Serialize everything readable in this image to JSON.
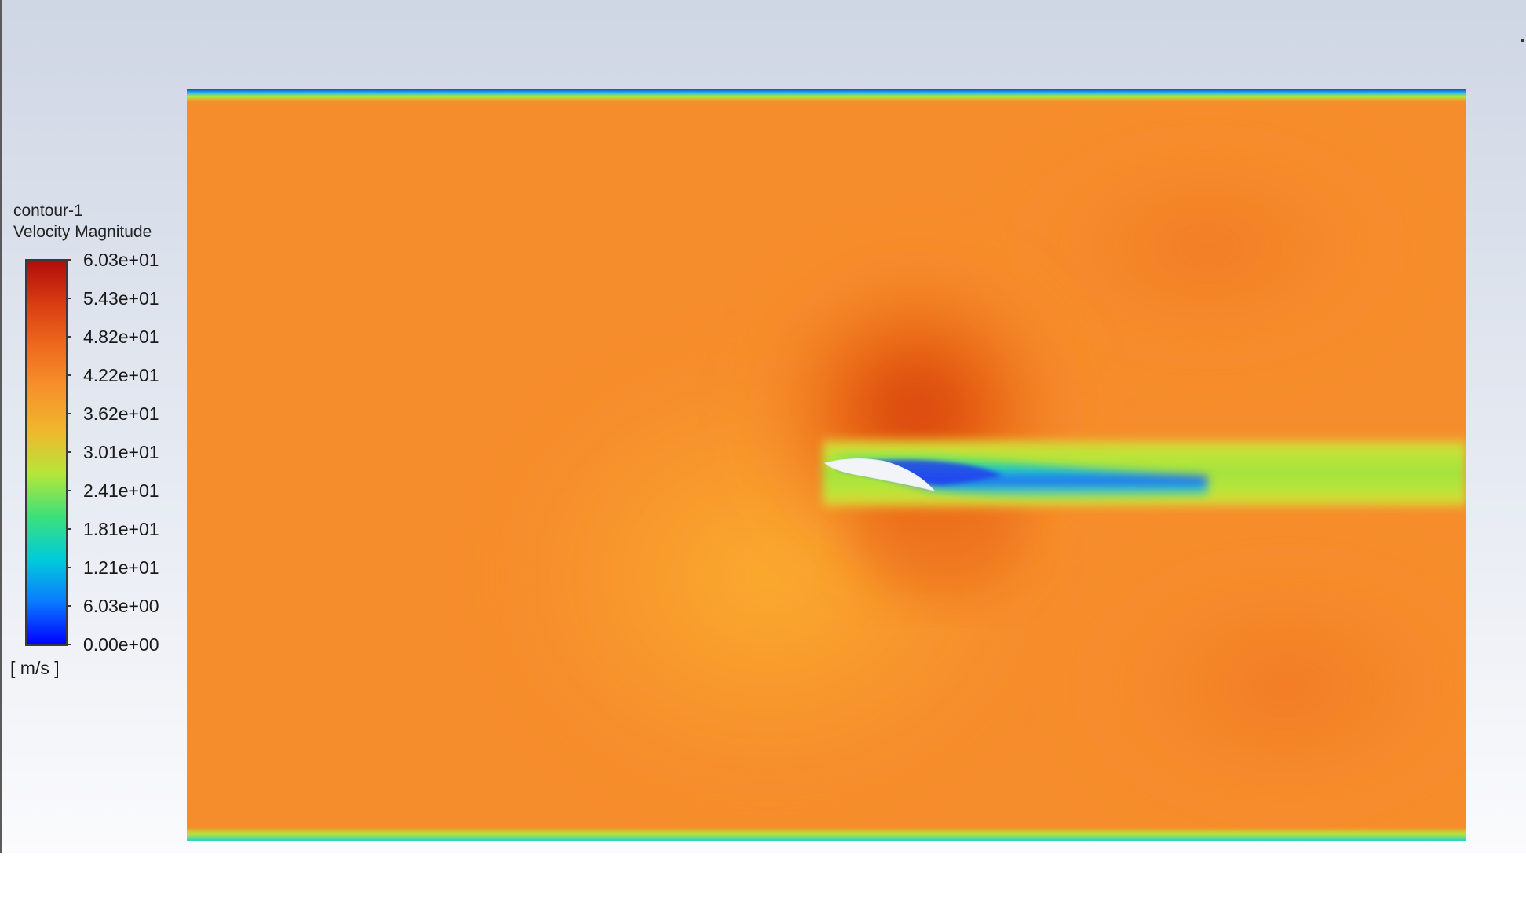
{
  "legend": {
    "name": "contour-1",
    "variable": "Velocity Magnitude",
    "unit": "[ m/s ]",
    "ticks": [
      "6.03e+01",
      "5.43e+01",
      "4.82e+01",
      "4.22e+01",
      "3.62e+01",
      "3.01e+01",
      "2.41e+01",
      "1.81e+01",
      "1.21e+01",
      "6.03e+00",
      "0.00e+00"
    ],
    "range": [
      0,
      60.3
    ],
    "colormap": [
      "#0000ff",
      "#0b7bff",
      "#00ccd8",
      "#3de07a",
      "#b6e63a",
      "#f0b72d",
      "#f7922c",
      "#ee6a1d",
      "#d83c12",
      "#b10c0c"
    ]
  },
  "field": {
    "freestream_color": "#f68d2c",
    "high_velocity_color": "#d9480f",
    "low_velocity_color": "#f8a52c",
    "wake_color": "#b8e23a",
    "wall_color": "#1a4cd8",
    "airfoil_color": "#f2f4f8"
  }
}
